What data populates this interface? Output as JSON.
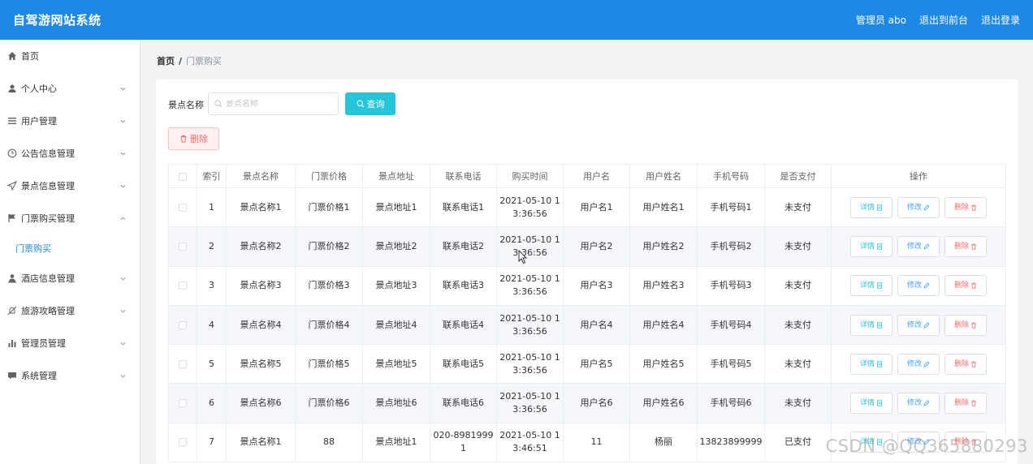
{
  "app": {
    "title": "自驾游网站系统"
  },
  "header": {
    "user_label": "管理员 abo",
    "frontend_link": "退出到前台",
    "logout_link": "退出登录"
  },
  "sidebar": {
    "items": [
      {
        "label": "首页",
        "icon": "home-icon",
        "expandable": false
      },
      {
        "label": "个人中心",
        "icon": "user-icon",
        "expandable": true
      },
      {
        "label": "用户管理",
        "icon": "list-icon",
        "expandable": true
      },
      {
        "label": "公告信息管理",
        "icon": "clock-icon",
        "expandable": true
      },
      {
        "label": "景点信息管理",
        "icon": "send-icon",
        "expandable": true
      },
      {
        "label": "门票购买管理",
        "icon": "flag-icon",
        "expandable": true,
        "expanded": true
      },
      {
        "label": "酒店信息管理",
        "icon": "person-icon",
        "expandable": true
      },
      {
        "label": "旅游攻略管理",
        "icon": "bell-off-icon",
        "expandable": true
      },
      {
        "label": "管理员管理",
        "icon": "chart-icon",
        "expandable": true
      },
      {
        "label": "系统管理",
        "icon": "chat-icon",
        "expandable": true
      }
    ],
    "sub_item": "门票购买"
  },
  "breadcrumb": {
    "home": "首页",
    "separator": "/",
    "current": "门票购买"
  },
  "search": {
    "label": "景点名称",
    "placeholder": "景点名称",
    "value": "",
    "button_label": "查询"
  },
  "toolbar": {
    "delete_label": "删除"
  },
  "table": {
    "columns": [
      "索引",
      "景点名称",
      "门票价格",
      "景点地址",
      "联系电话",
      "购买时间",
      "用户名",
      "用户姓名",
      "手机号码",
      "是否支付",
      "操作"
    ],
    "rows": [
      {
        "index": "1",
        "name": "景点名称1",
        "price": "门票价格1",
        "address": "景点地址1",
        "phone": "联系电话1",
        "time_a": "2021-05-10 1",
        "time_b": "3:36:56",
        "username": "用户名1",
        "realname": "用户姓名1",
        "mobile": "手机号码1",
        "paid": "未支付"
      },
      {
        "index": "2",
        "name": "景点名称2",
        "price": "门票价格2",
        "address": "景点地址2",
        "phone": "联系电话2",
        "time_a": "2021-05-10 1",
        "time_b": "3:36:56",
        "username": "用户名2",
        "realname": "用户姓名2",
        "mobile": "手机号码2",
        "paid": "未支付"
      },
      {
        "index": "3",
        "name": "景点名称3",
        "price": "门票价格3",
        "address": "景点地址3",
        "phone": "联系电话3",
        "time_a": "2021-05-10 1",
        "time_b": "3:36:56",
        "username": "用户名3",
        "realname": "用户姓名3",
        "mobile": "手机号码3",
        "paid": "未支付"
      },
      {
        "index": "4",
        "name": "景点名称4",
        "price": "门票价格4",
        "address": "景点地址4",
        "phone": "联系电话4",
        "time_a": "2021-05-10 1",
        "time_b": "3:36:56",
        "username": "用户名4",
        "realname": "用户姓名4",
        "mobile": "手机号码4",
        "paid": "未支付"
      },
      {
        "index": "5",
        "name": "景点名称5",
        "price": "门票价格5",
        "address": "景点地址5",
        "phone": "联系电话5",
        "time_a": "2021-05-10 1",
        "time_b": "3:36:56",
        "username": "用户名5",
        "realname": "用户姓名5",
        "mobile": "手机号码5",
        "paid": "未支付"
      },
      {
        "index": "6",
        "name": "景点名称6",
        "price": "门票价格6",
        "address": "景点地址6",
        "phone": "联系电话6",
        "time_a": "2021-05-10 1",
        "time_b": "3:36:56",
        "username": "用户名6",
        "realname": "用户姓名6",
        "mobile": "手机号码6",
        "paid": "未支付"
      },
      {
        "index": "7",
        "name": "景点名称1",
        "price": "88",
        "address": "景点地址1",
        "phone": "020-8981999 1",
        "time_a": "2021-05-10 1",
        "time_b": "3:46:51",
        "username": "11",
        "realname": "杨丽",
        "mobile": "13823899999",
        "paid": "已支付"
      }
    ],
    "actions": {
      "detail": "详情",
      "edit": "修改",
      "remove": "删除"
    }
  },
  "watermark": "CSDN @QQ365880293",
  "colors": {
    "header": "#1e88e5",
    "query_button": "#26c6da",
    "danger": "#f56c6c",
    "primary": "#409eff",
    "active_sub": "#1e88e5"
  }
}
